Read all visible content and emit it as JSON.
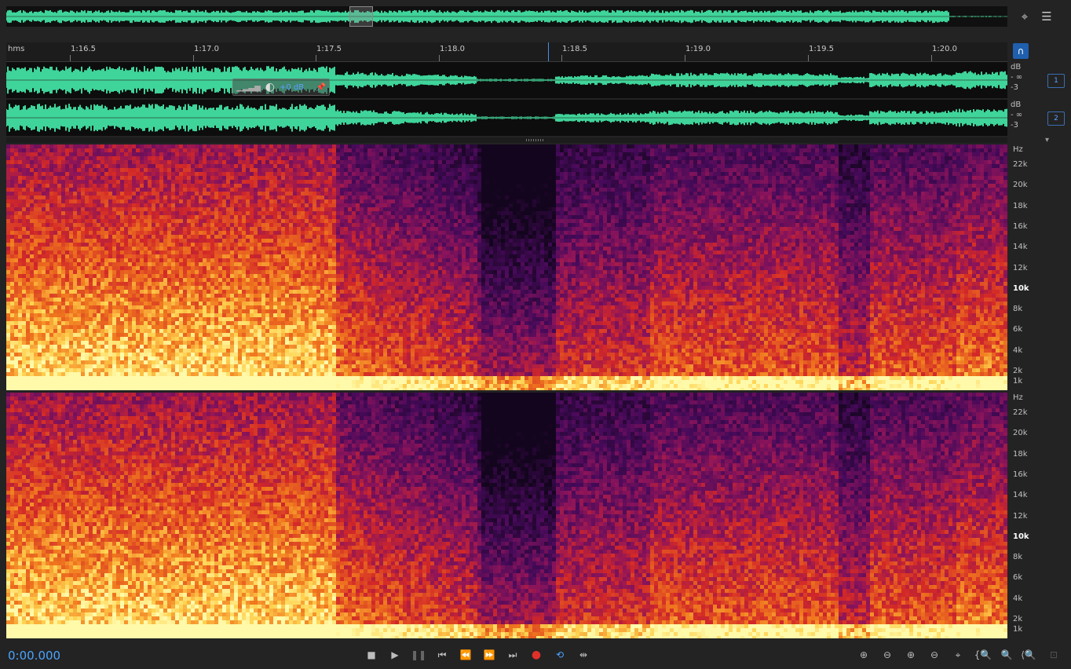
{
  "ruler": {
    "unit": "hms",
    "ticks": [
      "1:16.5",
      "1:17.0",
      "1:17.5",
      "1:18.0",
      "1:18.5",
      "1:19.0",
      "1:19.5",
      "1:20.0"
    ]
  },
  "channels": [
    {
      "number": "1",
      "db_unit": "dB",
      "db_inf": "- ∞",
      "db_low": "-3"
    },
    {
      "number": "2",
      "db_unit": "dB",
      "db_inf": "- ∞",
      "db_low": "-3"
    }
  ],
  "hud": {
    "gain": "+0 dB"
  },
  "spectrogram": {
    "unit": "Hz",
    "labels": [
      "22k",
      "20k",
      "18k",
      "16k",
      "14k",
      "12k",
      "10k",
      "8k",
      "6k",
      "4k",
      "2k",
      "1k"
    ]
  },
  "transport": {
    "timecode": "0:00.000"
  },
  "icons": {
    "overview_zoom": "zoom-icon",
    "overview_list": "list-icon",
    "ruler_button": "headphones-icon",
    "colors": {
      "accent": "#4a90e2",
      "waveform": "#3fd49a",
      "record": "#e0302a"
    }
  }
}
